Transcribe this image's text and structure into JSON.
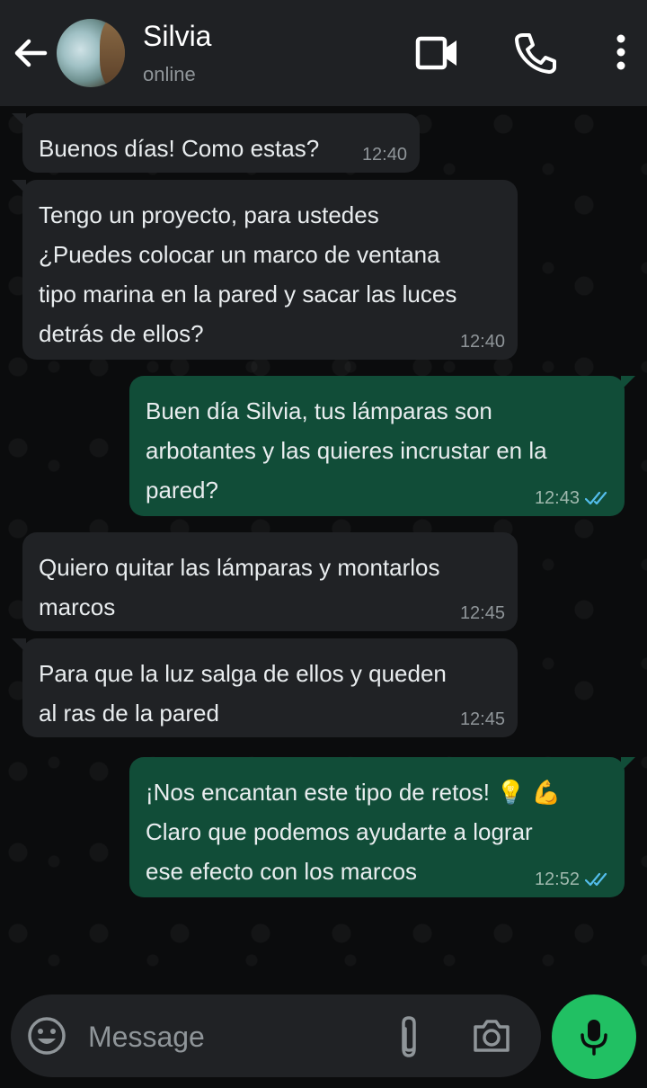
{
  "header": {
    "contact_name": "Silvia",
    "status": "online"
  },
  "colors": {
    "incoming_bubble": "#202225",
    "outgoing_bubble": "#114d38",
    "accent": "#21c063",
    "read_ticks": "#53bdeb"
  },
  "messages": [
    {
      "direction": "incoming",
      "lines": [
        "Buenos días! Como estas?"
      ],
      "time": "12:40"
    },
    {
      "direction": "incoming",
      "lines": [
        "Tengo un proyecto, para ustedes",
        "¿Puedes colocar un marco de ventana",
        "tipo marina en la pared y sacar las luces",
        "detrás de ellos?"
      ],
      "time": "12:40"
    },
    {
      "direction": "outgoing",
      "lines": [
        "Buen día Silvia, tus lámparas son",
        "arbotantes y las quieres incrustar en la",
        "pared?"
      ],
      "time": "12:43",
      "status": "read"
    },
    {
      "direction": "incoming",
      "lines": [
        "Quiero quitar las lámparas y montarlos",
        "marcos"
      ],
      "time": "12:45"
    },
    {
      "direction": "incoming",
      "lines": [
        "Para que la luz salga de ellos y queden",
        "al ras de la pared"
      ],
      "time": "12:45"
    },
    {
      "direction": "outgoing",
      "lines": [
        "¡Nos encantan este tipo de retos! 💡 💪",
        "Claro que podemos ayudarte a lograr",
        "ese efecto con los marcos"
      ],
      "time": "12:52",
      "status": "read"
    }
  ],
  "composer": {
    "placeholder": "Message"
  },
  "icons": {
    "back": "arrow-left-icon",
    "video": "video-camera-icon",
    "call": "phone-icon",
    "menu": "more-vertical-icon",
    "emoji": "emoji-icon",
    "attach": "paperclip-icon",
    "camera": "camera-icon",
    "mic": "microphone-icon"
  }
}
